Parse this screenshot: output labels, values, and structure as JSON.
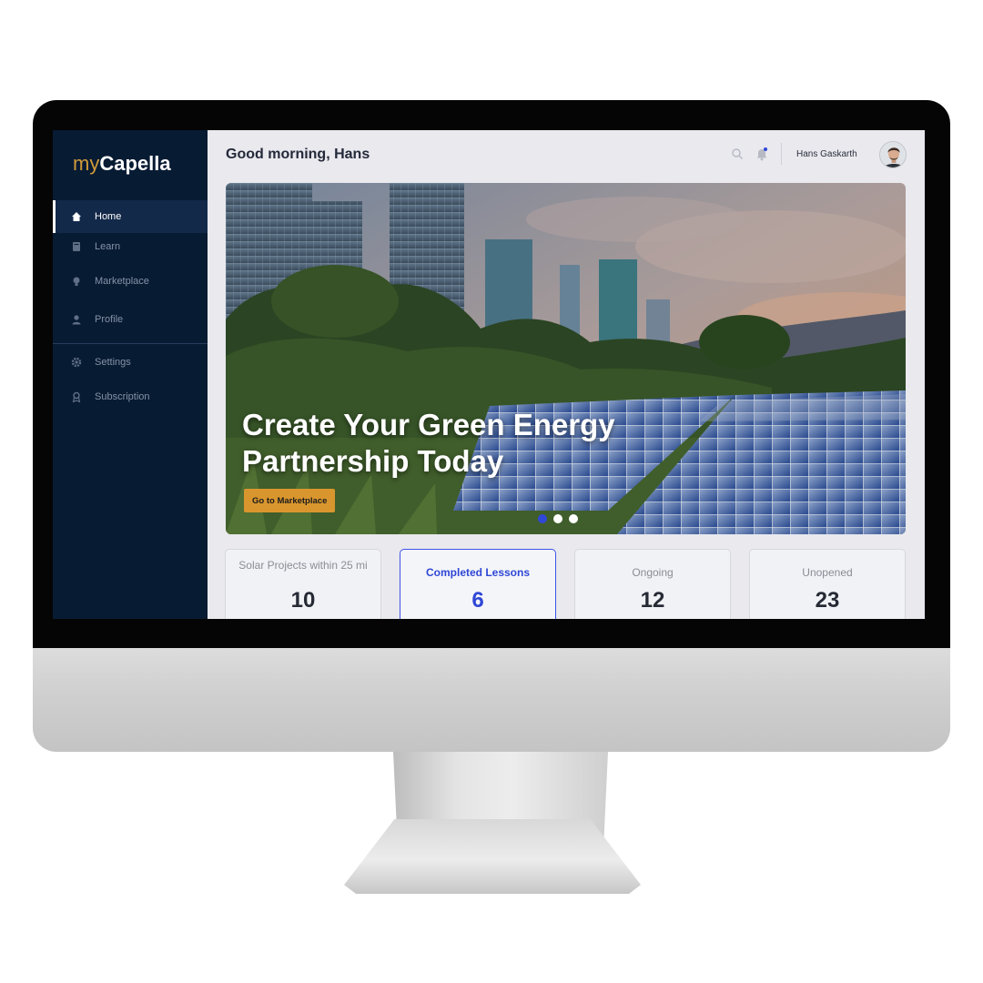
{
  "brand": {
    "prefix": "my",
    "name": "Capella"
  },
  "sidebar": {
    "items": [
      {
        "label": "Home",
        "icon": "home-icon",
        "active": true
      },
      {
        "label": "Learn",
        "icon": "book-icon",
        "active": false
      },
      {
        "label": "Marketplace",
        "icon": "lightbulb-icon",
        "active": false
      },
      {
        "label": "Profile",
        "icon": "user-icon",
        "active": false
      },
      {
        "label": "Settings",
        "icon": "gear-icon",
        "active": false
      },
      {
        "label": "Subscription",
        "icon": "badge-icon",
        "active": false
      }
    ]
  },
  "header": {
    "greeting": "Good morning, Hans",
    "user_name": "Hans Gaskarth",
    "icons": [
      "search-icon",
      "bell-icon"
    ]
  },
  "hero": {
    "title": "Create Your Green Energy Partnership Today",
    "button_label": "Go to Marketplace",
    "slides": 3,
    "active_slide": 1
  },
  "stats": [
    {
      "label": "Solar Projects within 25 mi",
      "value": "10",
      "active": false
    },
    {
      "label": "Completed Lessons",
      "value": "6",
      "active": true
    },
    {
      "label": "Ongoing",
      "value": "12",
      "active": false
    },
    {
      "label": "Unopened",
      "value": "23",
      "active": false
    }
  ],
  "colors": {
    "sidebar_bg": "#071b33",
    "brand_accent": "#d19a3a",
    "primary_button": "#d9962e",
    "active_blue": "#2f46d6"
  }
}
